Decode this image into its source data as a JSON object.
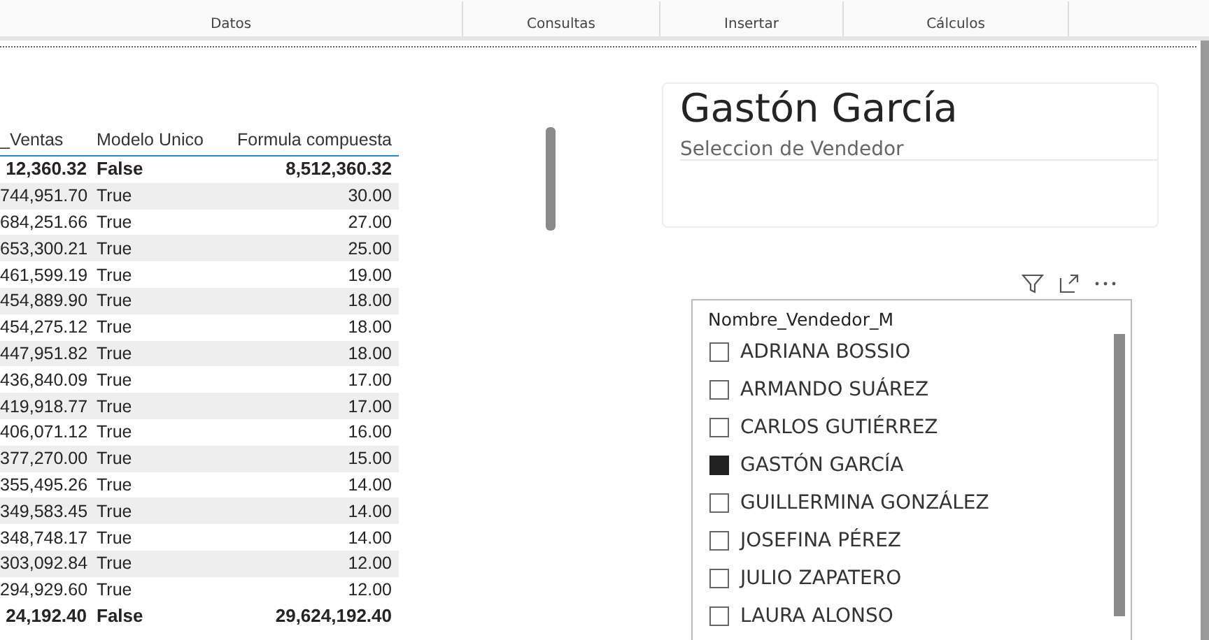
{
  "ribbon": {
    "groups": [
      "Datos",
      "Consultas",
      "Insertar",
      "Cálculos"
    ]
  },
  "table": {
    "columns": [
      "_Ventas",
      "Modelo Unico",
      "Formula compuesta"
    ],
    "rows": [
      {
        "total": true,
        "cells": [
          "12,360.32",
          "False",
          "8,512,360.32"
        ]
      },
      {
        "total": false,
        "cells": [
          "744,951.70",
          "True",
          "30.00"
        ]
      },
      {
        "total": false,
        "cells": [
          "684,251.66",
          "True",
          "27.00"
        ]
      },
      {
        "total": false,
        "cells": [
          "653,300.21",
          "True",
          "25.00"
        ]
      },
      {
        "total": false,
        "cells": [
          "461,599.19",
          "True",
          "19.00"
        ]
      },
      {
        "total": false,
        "cells": [
          "454,889.90",
          "True",
          "18.00"
        ]
      },
      {
        "total": false,
        "cells": [
          "454,275.12",
          "True",
          "18.00"
        ]
      },
      {
        "total": false,
        "cells": [
          "447,951.82",
          "True",
          "18.00"
        ]
      },
      {
        "total": false,
        "cells": [
          "436,840.09",
          "True",
          "17.00"
        ]
      },
      {
        "total": false,
        "cells": [
          "419,918.77",
          "True",
          "17.00"
        ]
      },
      {
        "total": false,
        "cells": [
          "406,071.12",
          "True",
          "16.00"
        ]
      },
      {
        "total": false,
        "cells": [
          "377,270.00",
          "True",
          "15.00"
        ]
      },
      {
        "total": false,
        "cells": [
          "355,495.26",
          "True",
          "14.00"
        ]
      },
      {
        "total": false,
        "cells": [
          "349,583.45",
          "True",
          "14.00"
        ]
      },
      {
        "total": false,
        "cells": [
          "348,748.17",
          "True",
          "14.00"
        ]
      },
      {
        "total": false,
        "cells": [
          "303,092.84",
          "True",
          "12.00"
        ]
      },
      {
        "total": false,
        "cells": [
          "294,929.60",
          "True",
          "12.00"
        ]
      },
      {
        "total": true,
        "cells": [
          "24,192.40",
          "False",
          "29,624,192.40"
        ]
      }
    ]
  },
  "card": {
    "value": "Gastón García",
    "label": "Seleccion de Vendedor"
  },
  "slicer": {
    "header": "Nombre_Vendedor_M",
    "items": [
      {
        "label": "ADRIANA BOSSIO",
        "selected": false
      },
      {
        "label": "ARMANDO SUÁREZ",
        "selected": false
      },
      {
        "label": "CARLOS GUTIÉRREZ",
        "selected": false
      },
      {
        "label": "GASTÓN GARCÍA",
        "selected": true
      },
      {
        "label": "GUILLERMINA GONZÁLEZ",
        "selected": false
      },
      {
        "label": "JOSEFINA PÉREZ",
        "selected": false
      },
      {
        "label": "JULIO ZAPATERO",
        "selected": false
      },
      {
        "label": "LAURA ALONSO",
        "selected": false
      }
    ]
  }
}
